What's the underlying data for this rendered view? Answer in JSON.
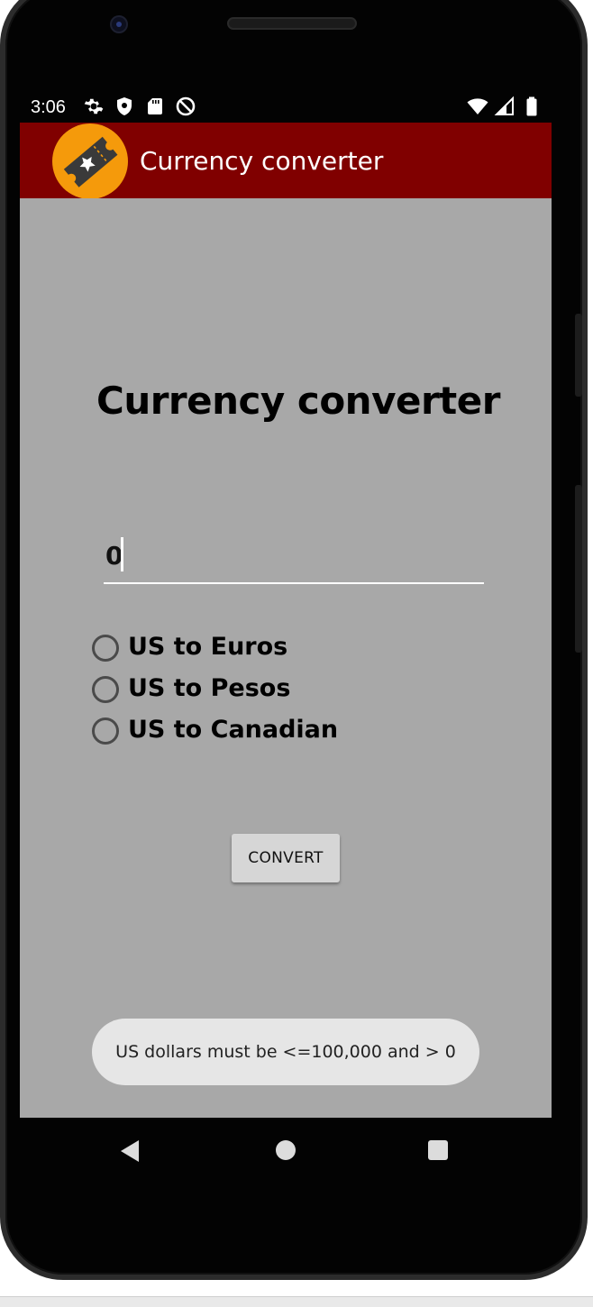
{
  "status_bar": {
    "time": "3:06",
    "icons_left": [
      "settings-icon",
      "shield-icon",
      "sd-card-icon",
      "do-not-disturb-icon"
    ],
    "icons_right": [
      "wifi-icon",
      "cell-signal-icon",
      "battery-icon"
    ]
  },
  "app_bar": {
    "title": "Currency converter",
    "logo_icon": "ticket-star-icon",
    "background": "#800000",
    "logo_color": "#f59a0b"
  },
  "main": {
    "heading": "Currency converter",
    "amount_input": {
      "value": "0"
    },
    "options": [
      {
        "label": "US to Euros",
        "selected": false
      },
      {
        "label": "US to Pesos",
        "selected": false
      },
      {
        "label": "US to Canadian",
        "selected": false
      }
    ],
    "convert_label": "CONVERT",
    "background": "#a8a8a8"
  },
  "toast": {
    "message": "US dollars must be <=100,000 and > 0"
  },
  "nav_bar": {
    "icons": [
      "back-icon",
      "home-icon",
      "recents-icon"
    ]
  }
}
